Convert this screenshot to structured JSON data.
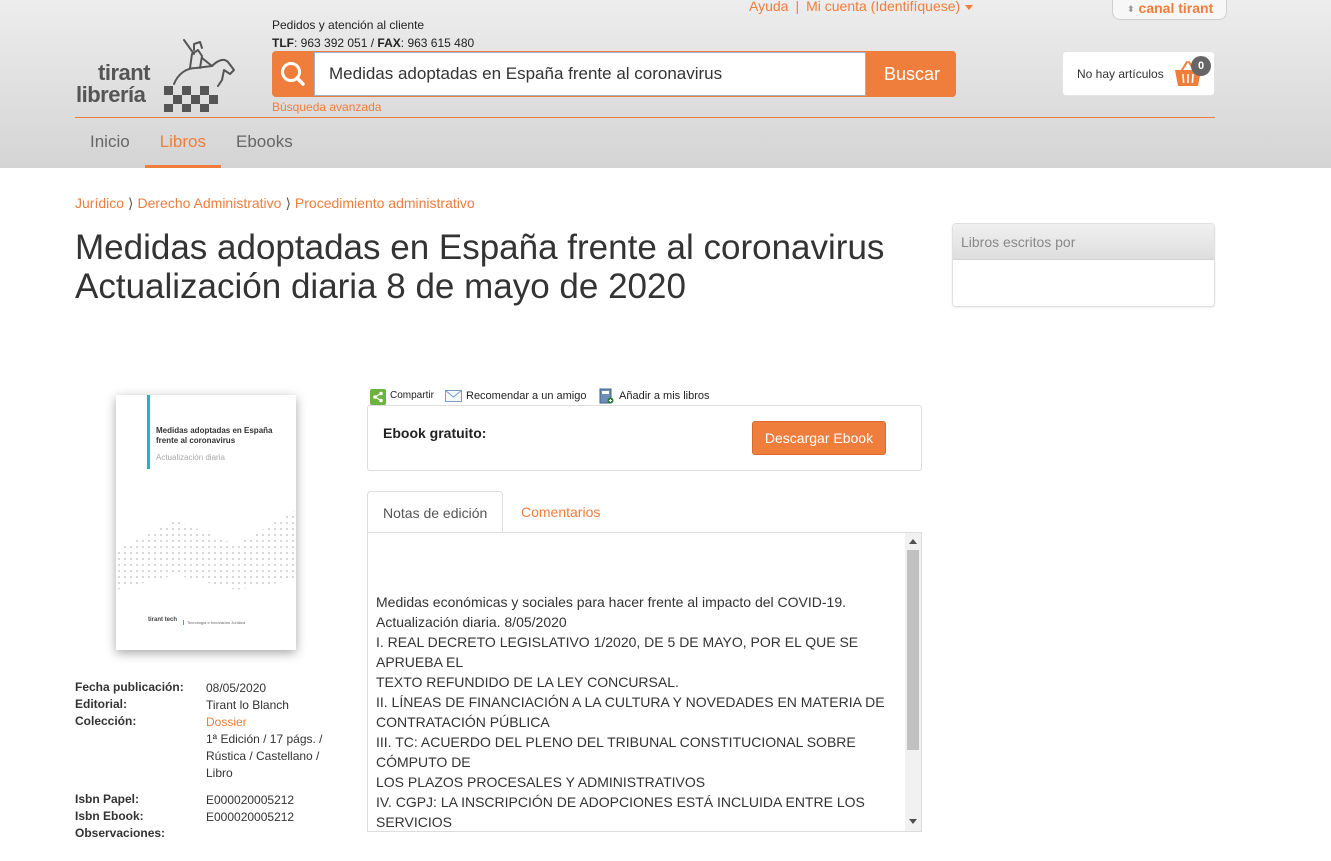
{
  "top_links": {
    "help": "Ayuda",
    "separator": "|",
    "account": "Mi cuenta (Identifíquese)"
  },
  "canal": {
    "label": "canal tirant"
  },
  "logo": {
    "line1": "tirant",
    "line2": "librería"
  },
  "contact": {
    "line1": "Pedidos y atención al cliente",
    "tlf_label": "TLF",
    "tlf": "963 392 051",
    "fax_label": "FAX",
    "fax": "963 615 480"
  },
  "search": {
    "value": "Medidas adoptadas en España frente al coronavirus",
    "button": "Buscar",
    "advanced": "Búsqueda avanzada"
  },
  "cart": {
    "text": "No hay artículos",
    "count": "0"
  },
  "nav": {
    "items": [
      "Inicio",
      "Libros",
      "Ebooks"
    ],
    "active": "Libros"
  },
  "breadcrumb": [
    "Jurídico",
    "Derecho Administrativo",
    "Procedimiento administrativo"
  ],
  "breadcrumb_sep": "⟩",
  "title": "Medidas adoptadas en España frente al coronavirus Actualización diaria 8 de mayo de 2020",
  "sidebar": {
    "heading": "Libros escritos por"
  },
  "cover": {
    "title": "Medidas adoptadas en España frente al coronavirus",
    "subtitle": "Actualización diaria",
    "brand": "tirant tech",
    "brand_sub": "Tecnología e Innovación Jurídica"
  },
  "details": {
    "fecha_label": "Fecha publicación:",
    "fecha": "08/05/2020",
    "editorial_label": "Editorial:",
    "editorial": "Tirant lo Blanch",
    "coleccion_label": "Colección:",
    "coleccion": "Dossier",
    "edicion_1": "1ª Edición / 17 págs. /",
    "edicion_2": "Rústica / Castellano /",
    "edicion_3": "Libro",
    "isbn_papel_label": "Isbn Papel:",
    "isbn_papel": "E000020005212",
    "isbn_ebook_label": "Isbn Ebook:",
    "isbn_ebook": "E000020005212",
    "observaciones_label": "Observaciones:"
  },
  "actions": {
    "share": "Compartir",
    "recommend": "Recomendar a un amigo",
    "add": "Añadir a mis libros"
  },
  "ebook": {
    "label": "Ebook gratuito:",
    "button": "Descargar Ebook"
  },
  "tabs": {
    "notes": "Notas de edición",
    "comments": "Comentarios"
  },
  "notes_lines": [
    "Medidas económicas y sociales para hacer frente al impacto del COVID-19.",
    "Actualización diaria. 8/05/2020",
    "I. REAL DECRETO LEGISLATIVO 1/2020, DE 5 DE MAYO, POR EL QUE SE",
    "APRUEBA EL",
    "TEXTO REFUNDIDO DE LA LEY CONCURSAL.",
    "II. LÍNEAS DE FINANCIACIÓN A LA CULTURA Y NOVEDADES EN MATERIA DE",
    "CONTRATACIÓN PÚBLICA",
    "III. TC: ACUERDO DEL PLENO DEL TRIBUNAL CONSTITUCIONAL SOBRE",
    "CÓMPUTO DE",
    "LOS PLAZOS PROCESALES Y ADMINISTRATIVOS",
    "IV. CGPJ: LA INSCRIPCIÓN DE ADOPCIONES ESTÁ INCLUIDA ENTRE LOS",
    "SERVICIOS"
  ],
  "colors": {
    "accent": "#ef7d3c",
    "teal": "#1fb4c6"
  }
}
